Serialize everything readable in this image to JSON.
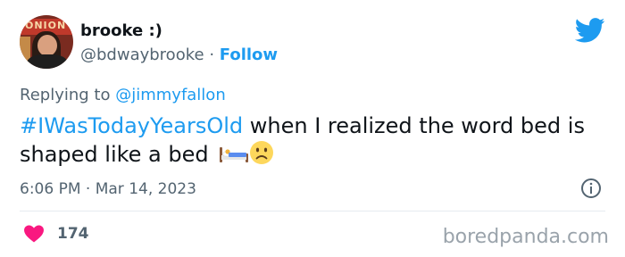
{
  "author": {
    "name": "brooke :)",
    "handle": "@bdwaybrooke",
    "separator": "·",
    "follow_label": "Follow",
    "avatar_sign_text": "ONION"
  },
  "reply": {
    "prefix": "Replying to",
    "mention": "@jimmyfallon"
  },
  "tweet": {
    "hashtag": "#IWasTodayYearsOld",
    "text": " when I realized the word bed is shaped like a bed ",
    "emojis": [
      "bed-emoji",
      "frowning-face-emoji"
    ]
  },
  "meta": {
    "time": "6:06 PM",
    "separator": "·",
    "date": "Mar 14, 2023"
  },
  "engagement": {
    "likes": "174"
  },
  "watermark": "boredpanda.com",
  "colors": {
    "accent": "#1d9bf0",
    "secondary_text": "#536471",
    "heart": "#f91880"
  }
}
